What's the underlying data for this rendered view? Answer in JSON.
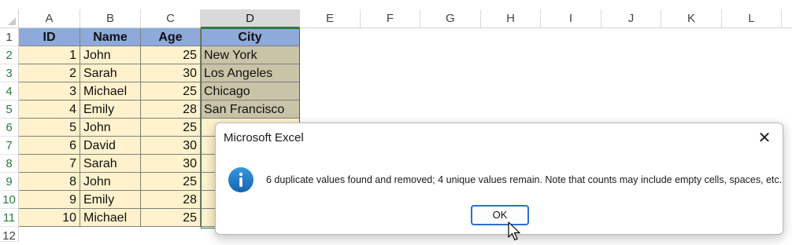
{
  "columns": [
    "A",
    "B",
    "C",
    "D",
    "E",
    "F",
    "G",
    "H",
    "I",
    "J",
    "K",
    "L"
  ],
  "rows": [
    "1",
    "2",
    "3",
    "4",
    "5",
    "6",
    "7",
    "8",
    "9",
    "10",
    "11",
    "12"
  ],
  "table": {
    "headers": [
      "ID",
      "Name",
      "Age",
      "City"
    ],
    "data": [
      [
        "1",
        "John",
        "25",
        "New York"
      ],
      [
        "2",
        "Sarah",
        "30",
        "Los Angeles"
      ],
      [
        "3",
        "Michael",
        "25",
        "Chicago"
      ],
      [
        "4",
        "Emily",
        "28",
        "San Francisco"
      ],
      [
        "5",
        "John",
        "25",
        ""
      ],
      [
        "6",
        "David",
        "30",
        ""
      ],
      [
        "7",
        "Sarah",
        "30",
        ""
      ],
      [
        "8",
        "John",
        "25",
        ""
      ],
      [
        "9",
        "Emily",
        "28",
        ""
      ],
      [
        "10",
        "Michael",
        "25",
        ""
      ]
    ]
  },
  "dialog": {
    "title": "Microsoft Excel",
    "close_label": "✕",
    "icon": "info-icon",
    "message": "6 duplicate values found and removed; 4 unique values remain. Note that counts may include empty cells, spaces, etc.",
    "ok_label": "OK"
  },
  "colors": {
    "header_fill": "#8eaadb",
    "data_fill": "#fff2cc",
    "selection_border": "#2b7a3d",
    "ok_border": "#2c6fd1",
    "info_icon": "#1e7cc8"
  }
}
